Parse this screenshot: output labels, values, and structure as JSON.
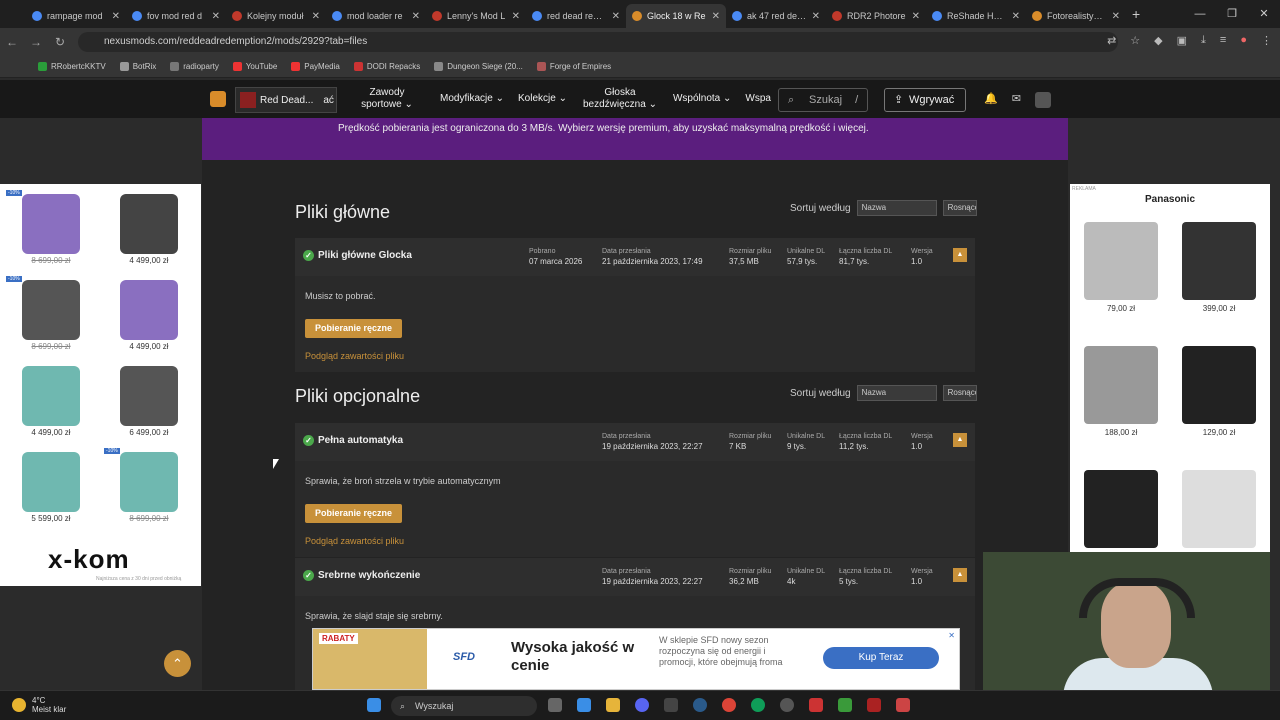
{
  "browser": {
    "tabs": [
      {
        "title": "rampage mod",
        "color": "#4a8af4"
      },
      {
        "title": "fov mod red d",
        "color": "#4a8af4"
      },
      {
        "title": "Kolejny moduł",
        "color": "#c0392b"
      },
      {
        "title": "mod loader re",
        "color": "#4a8af4"
      },
      {
        "title": "Lenny's Mod L",
        "color": "#c0392b"
      },
      {
        "title": "red dead reden",
        "color": "#4a8af4"
      },
      {
        "title": "Glock 18 w Re",
        "color": "#d98c2a",
        "active": true
      },
      {
        "title": "ak 47 red dead",
        "color": "#4a8af4"
      },
      {
        "title": "RDR2 Photore",
        "color": "#c0392b"
      },
      {
        "title": "ReShade Home",
        "color": "#4a8af4"
      },
      {
        "title": "Fotorealistyczn",
        "color": "#d98c2a"
      }
    ],
    "new_tab": "+",
    "url": "nexusmods.com/reddeadredemption2/mods/2929?tab=files",
    "bookmarks": [
      {
        "label": "RRobertcKKTV",
        "color": "#2a9d3a"
      },
      {
        "label": "BotRix",
        "color": "#999"
      },
      {
        "label": "radioparty",
        "color": "#777"
      },
      {
        "label": "YouTube",
        "color": "#e33"
      },
      {
        "label": "PayMedia",
        "color": "#e33"
      },
      {
        "label": "DODI Repacks",
        "color": "#c33"
      },
      {
        "label": "Dungeon Siege (20...",
        "color": "#888"
      },
      {
        "label": "Forge of Empires",
        "color": "#a55"
      }
    ]
  },
  "site_nav": {
    "game": "Red Dead...",
    "game_suffix": "ać",
    "menu": [
      "Zawody sportowe",
      "Modyfikacje",
      "Kolekcje",
      "Głoska bezdźwięczna",
      "Wspólnota",
      "Wspa"
    ],
    "search": "Szukaj",
    "search_shortcut": "/",
    "upload": "Wgrywać"
  },
  "banner": {
    "text": "Prędkość pobierania jest ograniczona do 3 MB/s. Wybierz wersję premium, aby uzyskać maksymalną prędkość i więcej."
  },
  "main_files": {
    "heading": "Pliki główne",
    "sort_label": "Sortuj według",
    "sort_value": "Nazwa",
    "sort_order": "Rosnąco",
    "file": {
      "name": "Pliki główne Glocka",
      "stats": [
        {
          "label": "Pobrano",
          "value": "07 marca 2026"
        },
        {
          "label": "Data przesłania",
          "value": "21 października 2023, 17:49"
        },
        {
          "label": "Rozmiar pliku",
          "value": "37,5 MB"
        },
        {
          "label": "Unikalne DL",
          "value": "57,9 tys."
        },
        {
          "label": "Łączna liczba DL",
          "value": "81,7 tys."
        },
        {
          "label": "Wersja",
          "value": "1.0"
        }
      ],
      "description": "Musisz to pobrać.",
      "button": "Pobieranie ręczne",
      "preview": "Podgląd zawartości pliku"
    }
  },
  "optional_files": {
    "heading": "Pliki opcjonalne",
    "sort_label": "Sortuj według",
    "sort_value": "Nazwa",
    "sort_order": "Rosnąco",
    "files": [
      {
        "name": "Pełna automatyka",
        "stats": [
          {
            "label": "Data przesłania",
            "value": "19 października 2023, 22:27"
          },
          {
            "label": "Rozmiar pliku",
            "value": "7 KB"
          },
          {
            "label": "Unikalne DL",
            "value": "9 tys."
          },
          {
            "label": "Łączna liczba DL",
            "value": "11,2 tys."
          },
          {
            "label": "Wersja",
            "value": "1.0"
          }
        ],
        "description": "Sprawia, że broń strzela w trybie automatycznym",
        "button": "Pobieranie ręczne",
        "preview": "Podgląd zawartości pliku"
      },
      {
        "name": "Srebrne wykończenie",
        "stats": [
          {
            "label": "Data przesłania",
            "value": "19 października 2023, 22:27"
          },
          {
            "label": "Rozmiar pliku",
            "value": "36,2 MB"
          },
          {
            "label": "Unikalne DL",
            "value": "4k"
          },
          {
            "label": "Łączna liczba DL",
            "value": "5 tys."
          },
          {
            "label": "Wersja",
            "value": "1.0"
          }
        ],
        "description": "Sprawia, że slajd staje się srebrny."
      }
    ]
  },
  "left_ad": {
    "products": [
      {
        "price": "8 699,00 zł",
        "strike": true,
        "color": "#8a6fc0",
        "badge": "-10%"
      },
      {
        "price": "4 499,00 zł",
        "strike": false,
        "color": "#444"
      },
      {
        "price": "8 699,00 zł",
        "strike": true,
        "color": "#555",
        "badge": "-10%"
      },
      {
        "price": "4 499,00 zł",
        "strike": false,
        "color": "#8a6fc0"
      },
      {
        "price": "4 499,00 zł",
        "strike": false,
        "color": "#6fb8b0"
      },
      {
        "price": "6 499,00 zł",
        "strike": false,
        "color": "#555"
      },
      {
        "price": "5 599,00 zł",
        "strike": false,
        "color": "#6fb8b0"
      },
      {
        "price": "8 699,00 zł",
        "strike": true,
        "color": "#6fb8b0",
        "badge": "-10%"
      }
    ],
    "brand": "x-kom",
    "note": "Najniższa cena z 30 dni przed obniżką"
  },
  "right_ad": {
    "label": "REKLAMA",
    "brand": "Panasonic",
    "products": [
      {
        "price": "79,00 zł",
        "color": "#bbb"
      },
      {
        "price": "399,00 zł",
        "color": "#333"
      },
      {
        "price": "188,00 zł",
        "color": "#999"
      },
      {
        "price": "129,00 zł",
        "color": "#222"
      },
      {
        "price": "",
        "color": "#222"
      },
      {
        "price": "",
        "color": "#ddd"
      }
    ]
  },
  "bottom_ad": {
    "badge": "RABATY",
    "logo": "SFD",
    "headline": "Wysoka jakość w cenie",
    "body": "W sklepie SFD nowy sezon rozpoczyna się od energii i promocji, które obejmują froma",
    "cta": "Kup Teraz"
  },
  "taskbar": {
    "temp": "4°C",
    "weather": "Meist klar",
    "search": "Wyszukaj"
  }
}
